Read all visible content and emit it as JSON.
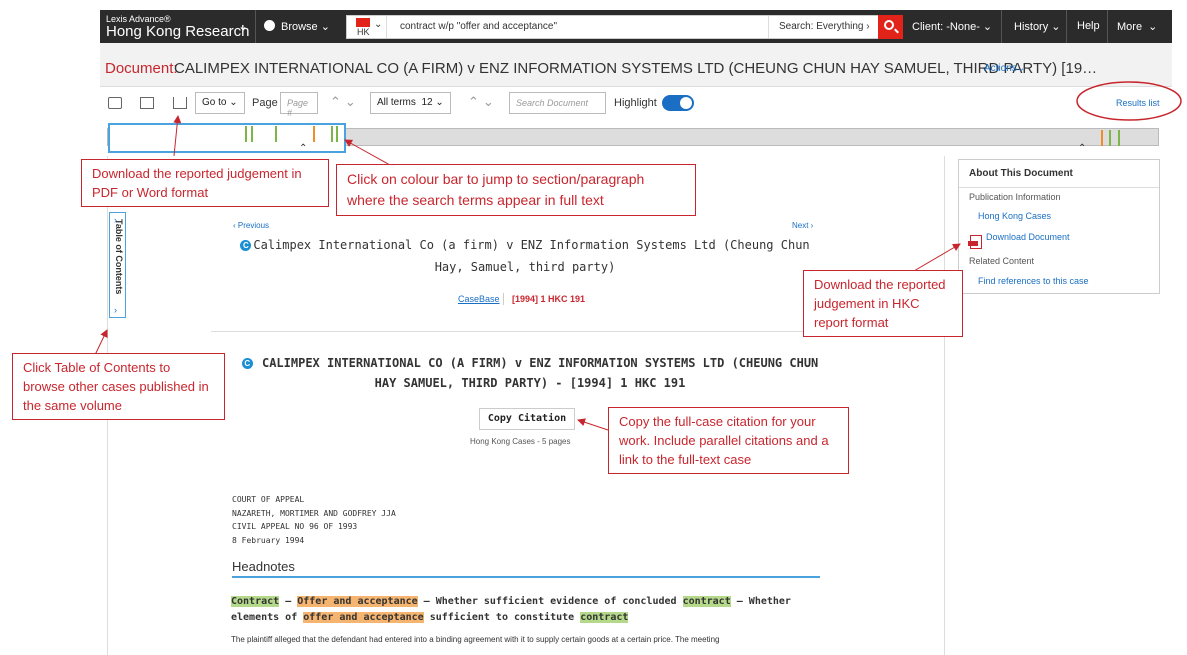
{
  "topnav": {
    "brand_line1": "Lexis Advance®",
    "brand_line2": "Hong Kong Research",
    "browse": "Browse",
    "jurisdiction": "HK",
    "query": "contract w/p \"offer and acceptance\"",
    "search_scope": "Search: Everything",
    "client": "Client: -None-",
    "history": "History",
    "help": "Help",
    "more": "More"
  },
  "titlebar": {
    "label": "Document:",
    "title": "CALIMPEX INTERNATIONAL CO (A FIRM) v ENZ INFORMATION SYSTEMS LTD (CHEUNG CHUN HAY SAMUEL, THIRD PARTY) [19…",
    "actions": "Actions"
  },
  "toolbar": {
    "goto": "Go to",
    "page_label": "Page",
    "page_placeholder": "Page #",
    "terms": "All terms",
    "term_count": "12",
    "search_placeholder": "Search Document",
    "highlight": "Highlight",
    "results_list": "Results list"
  },
  "hitbar": {
    "colors": {
      "green": "#7ab648",
      "orange": "#f28c28"
    }
  },
  "toc": {
    "label": "Table of Contents"
  },
  "document": {
    "previous": "Previous",
    "next": "Next",
    "case_title": "Calimpex International Co (a firm) v ENZ Information Systems Ltd (Cheung Chun Hay, Samuel, third party)",
    "casebase": "CaseBase",
    "citation": "[1994] 1 HKC 191",
    "big_title": "CALIMPEX INTERNATIONAL CO (A FIRM) v ENZ INFORMATION SYSTEMS LTD (CHEUNG CHUN HAY SAMUEL, THIRD PARTY) - [1994] 1 HKC 191",
    "copy_citation": "Copy Citation",
    "source_info": "Hong Kong Cases - 5 pages",
    "court": "COURT OF APPEAL",
    "judges": "NAZARETH, MORTIMER AND GODFREY JJA",
    "appeal_no": "CIVIL APPEAL NO 96 OF 1993",
    "date": "8 February 1994",
    "headnotes": "Headnotes",
    "headnote": {
      "t1": "Contract",
      "t2": " — ",
      "t3": "Offer and acceptance",
      "t4": " — Whether sufficient evidence of concluded ",
      "t5": "contract",
      "t6": " — Whether elements of ",
      "t7": "offer and acceptance",
      "t8": " sufficient to constitute ",
      "t9": "contract"
    },
    "paragraph": "The plaintiff alleged that the defendant had entered into a binding agreement with it to supply certain goods at a certain price. The meeting"
  },
  "rightpanel": {
    "title": "About This Document",
    "pub_info": "Publication Information",
    "hk_cases": "Hong Kong Cases",
    "download": "Download Document",
    "related": "Related Content",
    "find_refs": "Find references to this case"
  },
  "annotations": {
    "download_pdf": "Download the reported judgement in PDF or Word format",
    "colour_bar": "Click on colour bar to jump to section/paragraph where the search terms appear in full text",
    "download_hkc": "Download the reported judgement in HKC report format",
    "toc_tip": "Click Table of Contents to browse other cases published in the same volume",
    "copy_tip": "Copy the full-case citation for your work. Include parallel citations and a link to the full-text case",
    "accent_color": "#c8262e"
  }
}
